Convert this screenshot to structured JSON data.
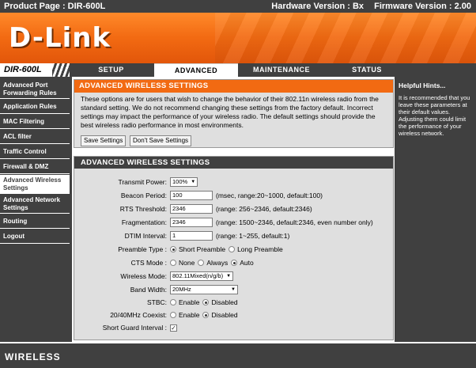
{
  "topbar": {
    "product": "Product Page : DIR-600L",
    "hardware": "Hardware Version : Bx",
    "firmware": "Firmware Version : 2.00"
  },
  "logo": "D-Link",
  "model": "DIR-600L",
  "tabs": [
    "SETUP",
    "ADVANCED",
    "MAINTENANCE",
    "STATUS"
  ],
  "sidebar": {
    "items": [
      {
        "label": "Advanced Port Forwarding Rules"
      },
      {
        "label": "Application Rules"
      },
      {
        "label": "MAC Filtering"
      },
      {
        "label": "ACL filter"
      },
      {
        "label": "Traffic Control"
      },
      {
        "label": "Firewall & DMZ"
      },
      {
        "label": "Advanced Wireless Settings"
      },
      {
        "label": "Advanced Network Settings"
      },
      {
        "label": "Routing"
      },
      {
        "label": "Logout"
      }
    ]
  },
  "intro": {
    "title": "ADVANCED WIRELESS SETTINGS",
    "text": "These options are for users that wish to change the behavior of their 802.11n wireless radio from the standard setting. We do not recommend changing these settings from the factory default. Incorrect settings may impact the performance of your wireless radio. The default settings should provide the best wireless radio performance in most environments.",
    "save_label": "Save Settings",
    "dont_save_label": "Don't Save Settings"
  },
  "settings": {
    "title": "ADVANCED WIRELESS SETTINGS",
    "transmit_power": {
      "label": "Transmit Power:",
      "value": "100%"
    },
    "beacon_period": {
      "label": "Beacon Period:",
      "value": "100",
      "note": "(msec, range:20~1000, default:100)"
    },
    "rts_threshold": {
      "label": "RTS Threshold:",
      "value": "2346",
      "note": "(range: 256~2346, default:2346)"
    },
    "fragmentation": {
      "label": "Fragmentation:",
      "value": "2346",
      "note": "(range: 1500~2346, default:2346, even number only)"
    },
    "dtim_interval": {
      "label": "DTIM Interval:",
      "value": "1",
      "note": "(range: 1~255, default:1)"
    },
    "preamble_type": {
      "label": "Preamble Type :",
      "options": [
        "Short Preamble",
        "Long Preamble"
      ],
      "selected": "Short Preamble"
    },
    "cts_mode": {
      "label": "CTS Mode :",
      "options": [
        "None",
        "Always",
        "Auto"
      ],
      "selected": "Auto"
    },
    "wireless_mode": {
      "label": "Wireless Mode:",
      "value": "802.11Mixed(n/g/b)"
    },
    "band_width": {
      "label": "Band Width:",
      "value": "20MHz"
    },
    "stbc": {
      "label": "STBC:",
      "options": [
        "Enable",
        "Disabled"
      ],
      "selected": "Disabled"
    },
    "coexist": {
      "label": "20/40MHz Coexist:",
      "options": [
        "Enable",
        "Disabled"
      ],
      "selected": "Disabled"
    },
    "short_guard": {
      "label": "Short Guard Interval :",
      "checked": true
    }
  },
  "hints": {
    "title": "Helpful Hints...",
    "text": "It is recommended that you leave these parameters at their default values. Adjusting them could limit the performance of your wireless network."
  },
  "footer": "WIRELESS"
}
